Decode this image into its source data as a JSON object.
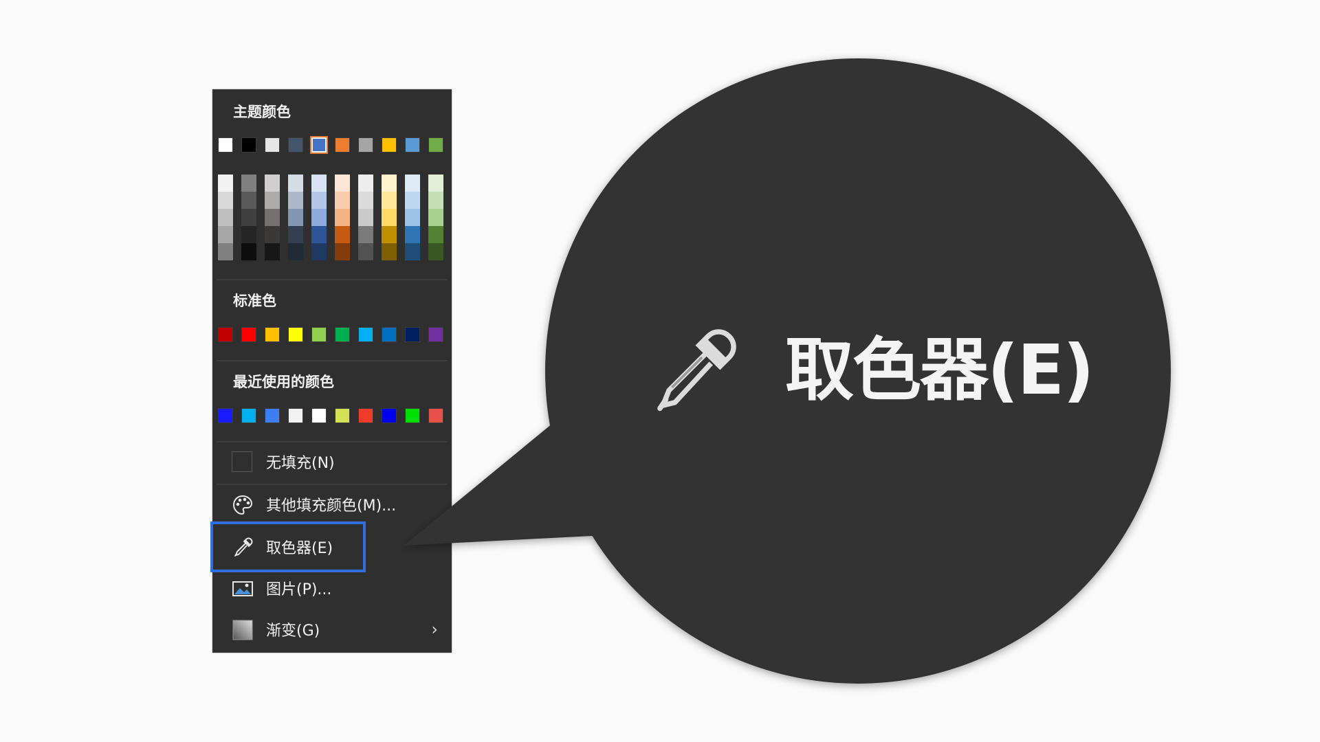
{
  "theme_colors": {
    "title": "主题颜色",
    "base": [
      "#ffffff",
      "#000000",
      "#e7e6e6",
      "#44546a",
      "#4472c4",
      "#ed7d31",
      "#a5a5a5",
      "#ffc000",
      "#5b9bd5",
      "#70ad47"
    ],
    "selected_index": 4,
    "shades": [
      [
        "#f2f2f2",
        "#d9d9d9",
        "#bfbfbf",
        "#a6a6a6",
        "#808080"
      ],
      [
        "#808080",
        "#595959",
        "#404040",
        "#262626",
        "#0d0d0d"
      ],
      [
        "#d0cece",
        "#aeabab",
        "#767171",
        "#3b3838",
        "#181717"
      ],
      [
        "#d6dce5",
        "#adb9ca",
        "#8497b0",
        "#333f50",
        "#222a35"
      ],
      [
        "#d9e2f3",
        "#b4c7e7",
        "#8faadc",
        "#2f5597",
        "#1f3864"
      ],
      [
        "#fbe5d6",
        "#f8cbad",
        "#f4b183",
        "#c55a11",
        "#843c0c"
      ],
      [
        "#ededed",
        "#dbdbdb",
        "#c9c9c9",
        "#7b7b7b",
        "#525252"
      ],
      [
        "#fff2cc",
        "#ffe699",
        "#ffd966",
        "#bf9000",
        "#7f6000"
      ],
      [
        "#deebf7",
        "#bdd7ee",
        "#9dc3e6",
        "#2e75b6",
        "#1f4e79"
      ],
      [
        "#e2f0d9",
        "#c5e0b4",
        "#a9d18e",
        "#548235",
        "#385723"
      ]
    ]
  },
  "standard_colors": {
    "title": "标准色",
    "colors": [
      "#c00000",
      "#ff0000",
      "#ffc000",
      "#ffff00",
      "#92d050",
      "#00b050",
      "#00b0f0",
      "#0070c0",
      "#002060",
      "#7030a0"
    ]
  },
  "recent_colors": {
    "title": "最近使用的颜色",
    "colors": [
      "#1a1aff",
      "#00b0f0",
      "#3d7df5",
      "#f2f2f2",
      "#ffffff",
      "#d4e157",
      "#f23c2a",
      "#0000ee",
      "#00e000",
      "#e8504a"
    ]
  },
  "menu": {
    "no_fill": "无填充(N)",
    "more_colors": "其他填充颜色(M)...",
    "eyedropper": "取色器(E)",
    "picture": "图片(P)...",
    "gradient": "渐变(G)",
    "chevron": "›"
  },
  "callout": {
    "label": "取色器(E)"
  },
  "icons": {
    "palette": "palette-icon",
    "eyedropper": "eyedropper-icon",
    "picture": "picture-icon",
    "gradient": "gradient-icon"
  }
}
